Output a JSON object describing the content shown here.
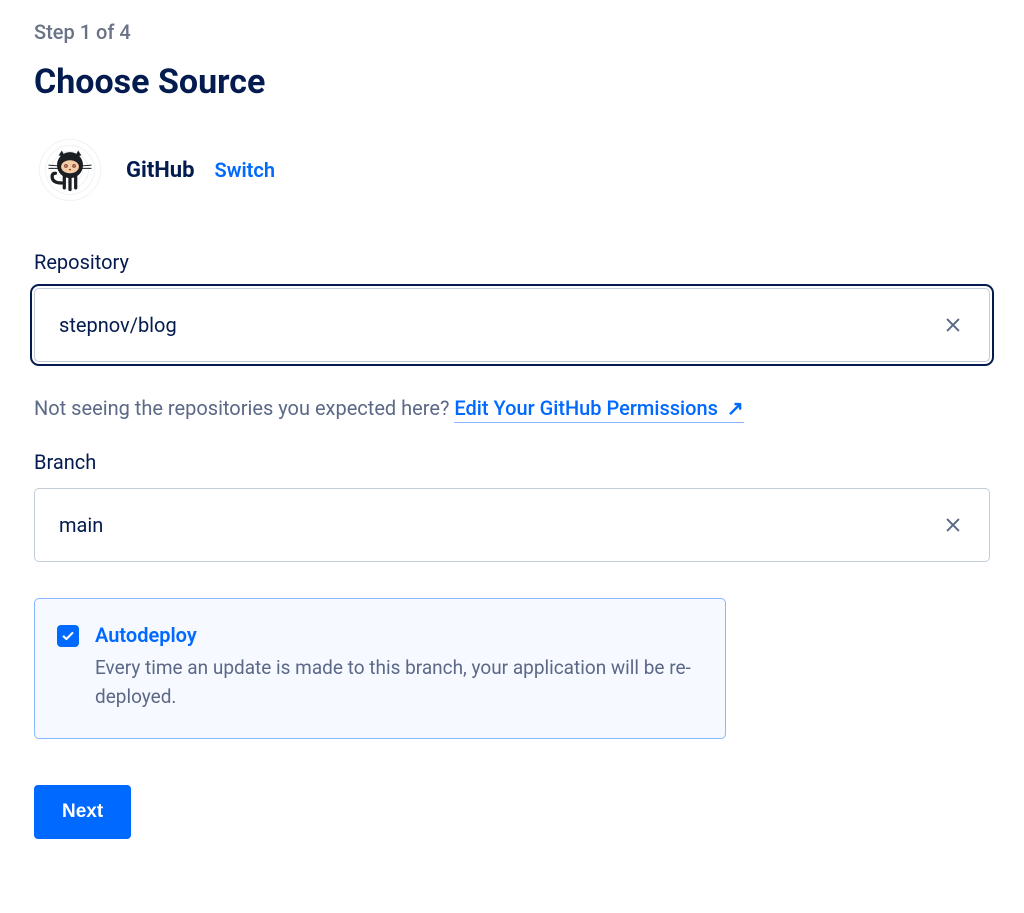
{
  "step": {
    "indicator": "Step 1 of 4"
  },
  "title": "Choose Source",
  "source": {
    "provider_name": "GitHub",
    "switch_label": "Switch",
    "icon": "github-octocat"
  },
  "repository": {
    "label": "Repository",
    "value": "stepnov/blog"
  },
  "permissions_help": {
    "text": "Not seeing the repositories you expected here? ",
    "link_label": "Edit Your GitHub Permissions"
  },
  "branch": {
    "label": "Branch",
    "value": "main"
  },
  "autodeploy": {
    "checked": true,
    "title": "Autodeploy",
    "description": "Every time an update is made to this branch, your application will be re-deployed."
  },
  "buttons": {
    "next": "Next"
  }
}
